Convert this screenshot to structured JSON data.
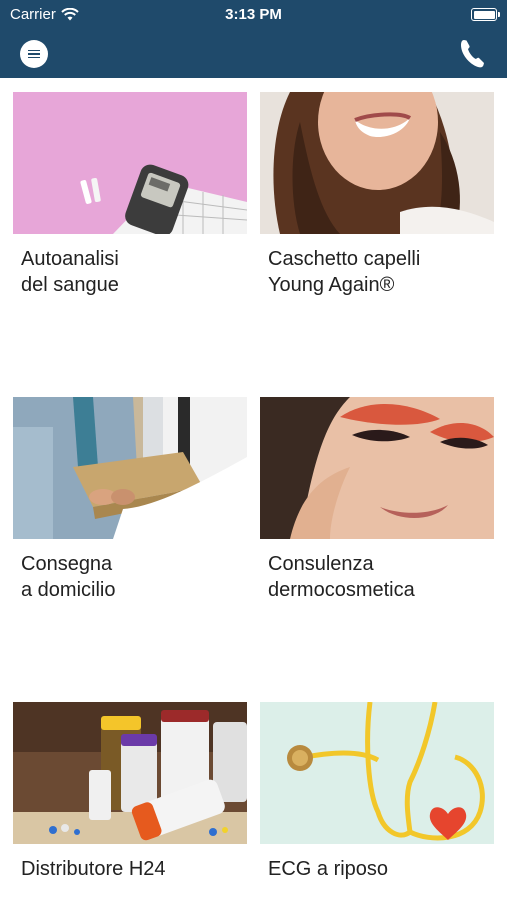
{
  "status_bar": {
    "carrier": "Carrier",
    "time": "3:13 PM"
  },
  "nav": {
    "menu_icon": "menu-icon",
    "phone_icon": "phone-icon",
    "color": "#1f4a6b"
  },
  "services": [
    {
      "title": "Autoanalisi\ndel sangue"
    },
    {
      "title": "Caschetto capelli\nYoung Again®"
    },
    {
      "title": "Consegna\na domicilio"
    },
    {
      "title": "Consulenza\ndermocosmetica"
    },
    {
      "title": "Distributore H24"
    },
    {
      "title": "ECG a riposo"
    }
  ]
}
